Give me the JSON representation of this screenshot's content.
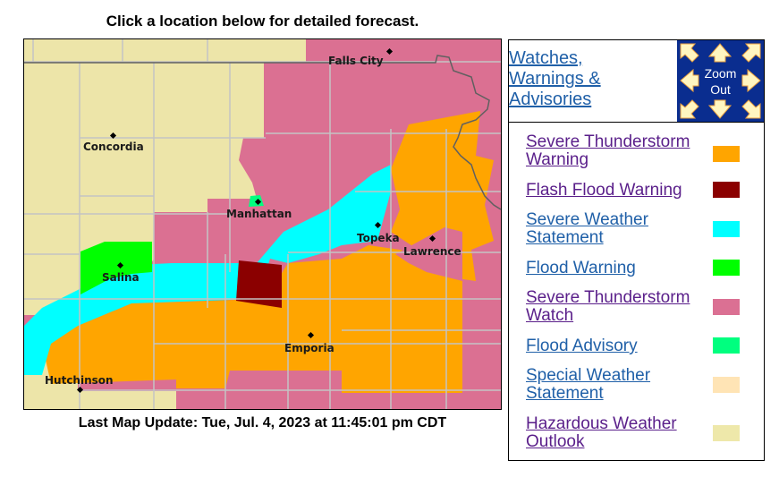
{
  "header": {
    "title": "Click a location below for detailed forecast."
  },
  "map": {
    "cities": [
      {
        "name": "Falls City"
      },
      {
        "name": "Concordia"
      },
      {
        "name": "Manhattan"
      },
      {
        "name": "Topeka"
      },
      {
        "name": "Lawrence"
      },
      {
        "name": "Salina"
      },
      {
        "name": "Emporia"
      },
      {
        "name": "Hutchinson"
      }
    ],
    "colors": {
      "background": "#ede5a9",
      "watch": "#db7092",
      "tstorm_warning": "#ffa500",
      "severe_statement": "#00ffff",
      "flood_warning": "#00ff00",
      "flash_flood": "#8b0000",
      "flood_advisory": "#00ff7f",
      "county_line": "#c4c4c4",
      "state_line": "#606060"
    }
  },
  "footer": {
    "update_text": "Last Map Update: Tue, Jul. 4, 2023 at 11:45:01 pm CDT"
  },
  "panel": {
    "wwa_link": {
      "line1": "Watches,",
      "line2": "Warnings &",
      "line3": "Advisories"
    },
    "zoom": {
      "line1": "Zoom",
      "line2": "Out"
    },
    "legend": [
      {
        "line1": "Severe Thunderstorm",
        "line2": "Warning",
        "color": "#ffa500",
        "visited": true
      },
      {
        "line1": "Flash Flood Warning",
        "line2": "",
        "color": "#8b0000",
        "visited": true
      },
      {
        "line1": "Severe Weather",
        "line2": "Statement",
        "color": "#00ffff",
        "visited": false
      },
      {
        "line1": "Flood Warning",
        "line2": "",
        "color": "#00ff00",
        "visited": false
      },
      {
        "line1": "Severe Thunderstorm",
        "line2": "Watch",
        "color": "#db7093",
        "visited": true
      },
      {
        "line1": "Flood Advisory",
        "line2": "",
        "color": "#00ff7f",
        "visited": false
      },
      {
        "line1": "Special Weather",
        "line2": "Statement",
        "color": "#ffe4b5",
        "visited": false
      },
      {
        "line1": "Hazardous Weather",
        "line2": "Outlook",
        "color": "#eee8aa",
        "visited": true
      }
    ]
  }
}
